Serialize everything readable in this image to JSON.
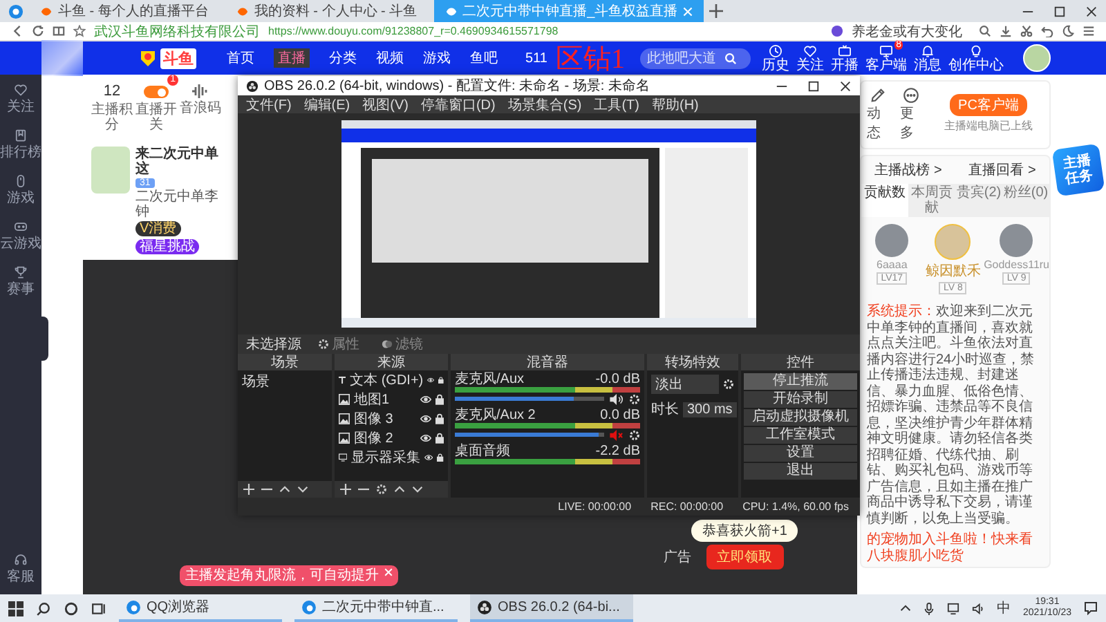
{
  "browser_tabs": [
    {
      "title": "斗鱼 - 每个人的直播平台",
      "selected": false
    },
    {
      "title": "我的资料 - 个人中心 - 斗鱼",
      "selected": false
    },
    {
      "title": "二次元中带中钟直播_斗鱼权益直播",
      "selected": true
    }
  ],
  "address_bar": {
    "site_name": "武汉斗鱼网络科技有限公司",
    "url": "https://www.douyu.com/91238807_r=0.4690934615571798",
    "news": "养老金或有大变化"
  },
  "header": {
    "logo": "斗鱼",
    "nav": [
      {
        "label": "首页",
        "selected": false
      },
      {
        "label": "直播",
        "selected": true
      },
      {
        "label": "分类",
        "selected": false
      },
      {
        "label": "视频",
        "selected": false
      },
      {
        "label": "游戏",
        "selected": false
      },
      {
        "label": "鱼吧",
        "selected": false
      }
    ],
    "room_number": "511",
    "overlay_text": "区钻1",
    "search_placeholder": "此地吧大道",
    "actions": [
      {
        "kind": "history",
        "label": "历史"
      },
      {
        "kind": "follow",
        "label": "关注"
      },
      {
        "kind": "broadcast",
        "label": "开播"
      },
      {
        "kind": "client",
        "label": "客户端",
        "badge": "8"
      },
      {
        "kind": "message",
        "label": "消息"
      },
      {
        "kind": "creator",
        "label": "创作中心"
      }
    ]
  },
  "sidebar": {
    "items": [
      {
        "kind": "follow",
        "label": "关注"
      },
      {
        "kind": "rank",
        "label": "排行榜"
      },
      {
        "kind": "game",
        "label": "游戏"
      },
      {
        "kind": "cloud_game",
        "label": "云游戏"
      },
      {
        "kind": "esports",
        "label": "赛事"
      }
    ],
    "bottom_item": {
      "kind": "service",
      "label": "客服"
    }
  },
  "stats": [
    {
      "kind": "number",
      "value": "12",
      "label": "主播积分"
    },
    {
      "kind": "toggle",
      "on": true,
      "badge": "1",
      "label": "直播开关"
    },
    {
      "kind": "wave",
      "label": "音浪码"
    }
  ],
  "streamer": {
    "title": "来二次元中单这",
    "level": "31",
    "name": "二次元中单李钟",
    "buttons": [
      "V消费",
      "福星挑战"
    ]
  },
  "player": {
    "toast": "主播发起角丸限流，可自动提升",
    "gift": "恭喜获火箭+1",
    "claim": "立即领取",
    "ad_label": "广告"
  },
  "obs": {
    "title": "OBS 26.0.2 (64-bit, windows) - 配置文件: 未命名 - 场景: 未命名",
    "menu": [
      "文件(F)",
      "编辑(E)",
      "视图(V)",
      "停靠窗口(D)",
      "场景集合(S)",
      "工具(T)",
      "帮助(H)"
    ],
    "source_bar": {
      "label": "未选择源",
      "buttons": [
        {
          "kind": "properties",
          "label": "属性",
          "disabled": true
        },
        {
          "kind": "filters",
          "label": "滤镜",
          "disabled": true
        }
      ]
    },
    "docks": {
      "scenes": "场景",
      "sources": "来源",
      "mixer": "混音器",
      "transitions": "转场特效",
      "controls": "控件"
    },
    "scenes": [
      "场景"
    ],
    "sources": [
      {
        "kind": "text",
        "name": "文本 (GDI+)"
      },
      {
        "kind": "image",
        "name": "地图1"
      },
      {
        "kind": "image",
        "name": "图像 3"
      },
      {
        "kind": "image",
        "name": "图像 2"
      },
      {
        "kind": "display",
        "name": "显示器采集"
      }
    ],
    "mixer": [
      {
        "kind": "full",
        "name": "麦克风/Aux",
        "reading": "-0.0 dB",
        "level": 0.8,
        "muted": false
      },
      {
        "kind": "full",
        "name": "麦克风/Aux 2",
        "reading": "0.0 dB",
        "level": 0.96,
        "muted": true
      },
      {
        "kind": "meter_only",
        "name": "桌面音频",
        "reading": "-2.2 dB"
      }
    ],
    "transition": {
      "type": "淡出",
      "duration_label": "时长",
      "duration": "300 ms"
    },
    "controls": [
      {
        "label": "停止推流",
        "active": true
      },
      {
        "label": "开始录制",
        "active": false
      },
      {
        "label": "启动虚拟摄像机",
        "active": false
      },
      {
        "label": "工作室模式",
        "active": false
      },
      {
        "label": "设置",
        "active": false
      },
      {
        "label": "退出",
        "active": false
      }
    ],
    "status": {
      "live": "LIVE: 00:00:00",
      "rec": "REC: 00:00:00",
      "cpu": "CPU: 1.4%, 60.00 fps"
    }
  },
  "right_panel": {
    "actions": [
      {
        "kind": "post",
        "label": "动态"
      },
      {
        "kind": "more",
        "label": "更多"
      }
    ],
    "client_button": "PC客户端",
    "client_note": "主播端电脑已上线",
    "links": [
      "主播战榜 >",
      "直播回看 >"
    ],
    "tabs": [
      {
        "label": "贡献数",
        "selected": true
      },
      {
        "label": "本周贡献",
        "selected": false
      },
      {
        "label": "贵宾(2)",
        "selected": false
      },
      {
        "label": "粉丝(0)",
        "selected": false
      }
    ],
    "users": [
      {
        "name": "6aaaa",
        "level": "LV17"
      },
      {
        "name": "鲸因默禾",
        "level": "LV 8"
      },
      {
        "name": "Goddess11ru",
        "level": "LV 9"
      }
    ],
    "notice_label": "系统提示：",
    "notice": "欢迎来到二次元中单李钟的直播间，喜欢就点点关注吧。斗鱼依法对直播内容进行24小时巡查，禁止传播违法违规、封建迷信、暴力血腥、低俗色情、招嫖诈骗、违禁品等不良信息，坚决维护青少年群体精神文明健康。请勿轻信各类招聘征婚、代练代抽、刷钻、购买礼包码、游戏币等广告信息，且如主播在推广商品中诱导私下交易，请谨慎判断，以免上当受骗。",
    "promo": "的宠物加入斗鱼啦！快来看八块腹肌小吃货",
    "task_badge": "主播任务"
  },
  "taskbar": {
    "apps": [
      {
        "kind": "browser",
        "label": "QQ浏览器",
        "selected": false
      },
      {
        "kind": "browser",
        "label": "二次元中带中钟直...",
        "selected": false
      },
      {
        "kind": "obs",
        "label": "OBS 26.0.2 (64-bi...",
        "selected": true
      }
    ],
    "ime": "中",
    "time": "19:31",
    "date": "2021/10/23"
  }
}
